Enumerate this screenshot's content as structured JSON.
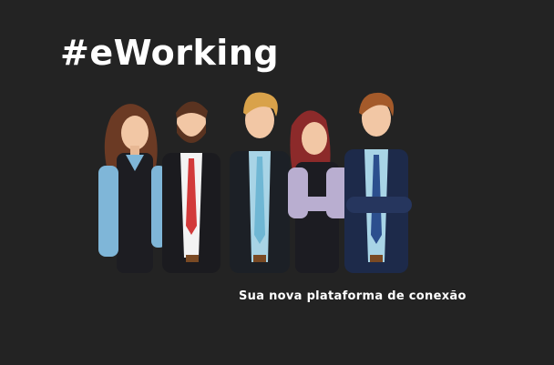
{
  "header": {
    "title": "#eWorking"
  },
  "footer": {
    "tagline": "Sua nova plataforma de conexão"
  },
  "illustration": {
    "icon": "business-team-illustration",
    "people": [
      {
        "role": "woman-left",
        "hair": "#6b3a24",
        "jacket": "#1d1d22",
        "shirt": "#7fb6d8"
      },
      {
        "role": "man-beard",
        "hair": "#5a3320",
        "jacket": "#1b1b1f",
        "tie": "#d23a3a"
      },
      {
        "role": "man-blond",
        "hair": "#d9a24a",
        "jacket": "#1c2026",
        "tie": "#6fb7d4"
      },
      {
        "role": "woman-red",
        "hair": "#8c2a2a",
        "jacket": "#b9aed0",
        "shirt": "#1c1c22"
      },
      {
        "role": "man-right",
        "hair": "#a45a2a",
        "jacket": "#1d2a4a",
        "tie": "#2c4f8e"
      }
    ]
  },
  "colors": {
    "background": "#232323",
    "text": "#ffffff"
  }
}
